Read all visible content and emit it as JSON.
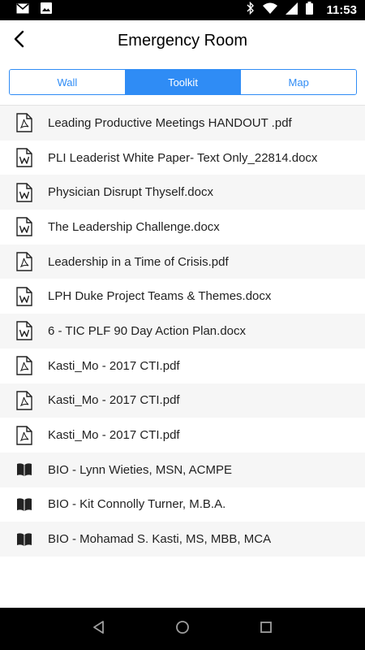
{
  "status_bar": {
    "time": "11:53",
    "icons": [
      "gmail-icon",
      "photo-icon",
      "bluetooth-icon",
      "wifi-icon",
      "signal-icon",
      "battery-icon"
    ]
  },
  "header": {
    "title": "Emergency Room",
    "back_icon": "back-arrow-icon"
  },
  "tabs": [
    {
      "label": "Wall",
      "active": false
    },
    {
      "label": "Toolkit",
      "active": true
    },
    {
      "label": "Map",
      "active": false
    }
  ],
  "files": [
    {
      "name": "Leading Productive Meetings HANDOUT .pdf",
      "icon": "pdf"
    },
    {
      "name": "PLI Leaderist White Paper- Text Only_22814.docx",
      "icon": "word"
    },
    {
      "name": "Physician Disrupt Thyself.docx",
      "icon": "word"
    },
    {
      "name": "The Leadership Challenge.docx",
      "icon": "word"
    },
    {
      "name": "Leadership in a Time of Crisis.pdf",
      "icon": "pdf"
    },
    {
      "name": "LPH Duke Project Teams & Themes.docx",
      "icon": "word"
    },
    {
      "name": "6 - TIC PLF 90 Day Action Plan.docx",
      "icon": "word"
    },
    {
      "name": "Kasti_Mo - 2017 CTI.pdf",
      "icon": "pdf"
    },
    {
      "name": "Kasti_Mo - 2017 CTI.pdf",
      "icon": "pdf"
    },
    {
      "name": "Kasti_Mo - 2017 CTI.pdf",
      "icon": "pdf"
    },
    {
      "name": "BIO - Lynn Wieties, MSN, ACMPE",
      "icon": "book"
    },
    {
      "name": "BIO - Kit Connolly Turner, M.B.A.",
      "icon": "book"
    },
    {
      "name": "BIO - Mohamad S. Kasti, MS, MBB, MCA",
      "icon": "book"
    }
  ],
  "nav_bar": {
    "icons": [
      "nav-back-icon",
      "nav-home-icon",
      "nav-recents-icon"
    ]
  },
  "colors": {
    "accent": "#2f8cf5",
    "status_bar": "#000000",
    "nav_bar": "#000000",
    "row_alt": "#f6f6f6"
  }
}
